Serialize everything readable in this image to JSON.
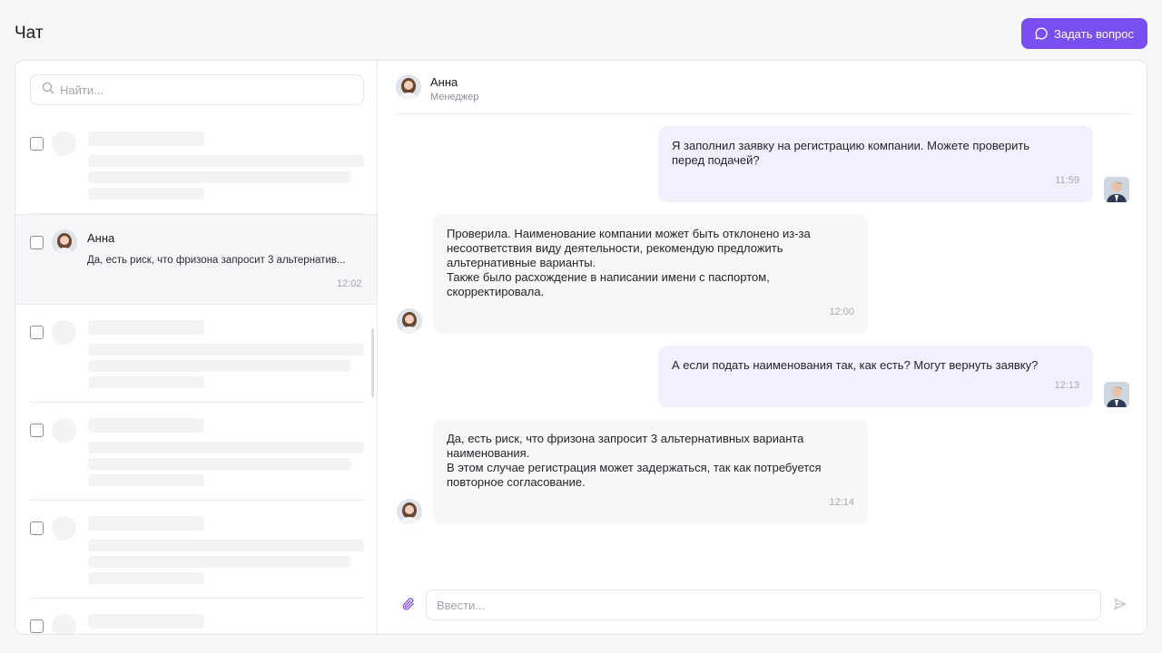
{
  "header": {
    "title": "Чат",
    "ask_button_label": "Задать вопрос"
  },
  "sidebar": {
    "search_placeholder": "Найти...",
    "active_chat": {
      "name": "Анна",
      "preview": "Да, есть риск, что фризона запросит 3 альтернатив...",
      "time": "12:02"
    }
  },
  "chat": {
    "contact": {
      "name": "Анна",
      "role": "Менеджер"
    },
    "messages": [
      {
        "direction": "out",
        "text": "Я заполнил заявку на регистрацию компании. Можете проверить\nперед подачей?",
        "time": "11:59"
      },
      {
        "direction": "in",
        "text": "Проверила. Наименование компании может быть отклонено из-за\nнесоответствия виду деятельности, рекомендую предложить\nальтернативные варианты.\nТакже было расхождение в написании имени с паспортом,\nскорректировала.",
        "time": "12:00"
      },
      {
        "direction": "out",
        "text": "А если подать наименования так, как есть? Могут вернуть заявку?",
        "time": "12:13"
      },
      {
        "direction": "in",
        "text": "Да, есть риск, что фризона запросит 3 альтернативных варианта\nнаименования.\nВ этом случае регистрация может задержаться, так как потребуется\nповторное согласование.",
        "time": "12:14"
      }
    ],
    "composer_placeholder": "Ввести..."
  },
  "colors": {
    "accent": "#7a4ff0",
    "outgoing_bubble": "#f3f0fd",
    "incoming_bubble": "#f7f7f8"
  }
}
